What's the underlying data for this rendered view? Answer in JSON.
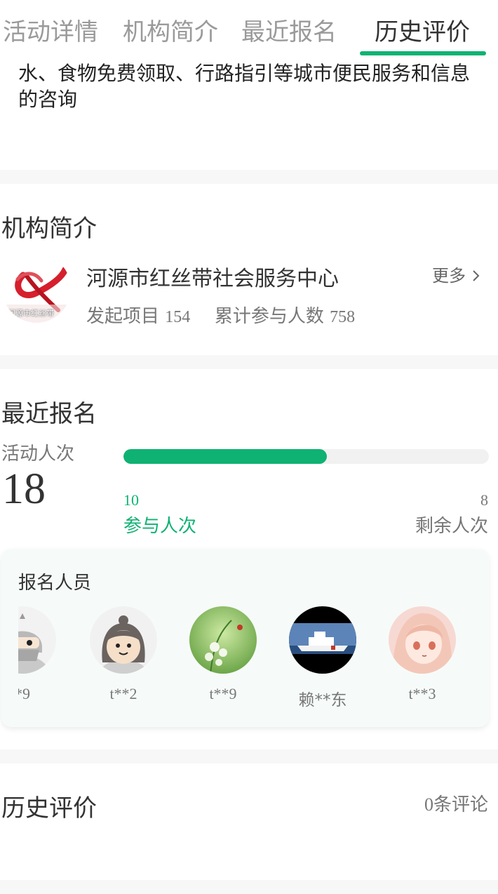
{
  "tabs": [
    {
      "label": "活动详情",
      "active": false
    },
    {
      "label": "机构简介",
      "active": false
    },
    {
      "label": "最近报名",
      "active": false
    },
    {
      "label": "历史评价",
      "active": true
    }
  ],
  "intro_text": "水、食物免费领取、行路指引等城市便民服务和信息的咨询",
  "org": {
    "section_title": "机构简介",
    "name": "河源市红丝带社会服务中心",
    "logo_caption": "河源市红丝带",
    "more_label": "更多",
    "projects_label": "发起项目",
    "projects_count": "154",
    "participants_label": "累计参与人数",
    "participants_count": "758"
  },
  "signup": {
    "section_title": "最近报名",
    "activity_label": "活动人次",
    "activity_count": "18",
    "joined_count": "10",
    "joined_label": "参与人次",
    "remaining_count": "8",
    "remaining_label": "剩余人次",
    "progress_fraction": 0.556,
    "members_title": "报名人员",
    "members": [
      {
        "name": "*9",
        "avatar": "ninja-avatar"
      },
      {
        "name": "t**2",
        "avatar": "girl-avatar"
      },
      {
        "name": "t**9",
        "avatar": "lily-flower-avatar"
      },
      {
        "name": "赖**东",
        "avatar": "ship-avatar"
      },
      {
        "name": "t**3",
        "avatar": "anime-girl-avatar"
      }
    ]
  },
  "reviews": {
    "section_title": "历史评价",
    "count": "0",
    "count_suffix": "条评论"
  },
  "colors": {
    "accent": "#0fb273",
    "divider": "#f7f7f7",
    "card_bg": "#f6fbf9"
  }
}
